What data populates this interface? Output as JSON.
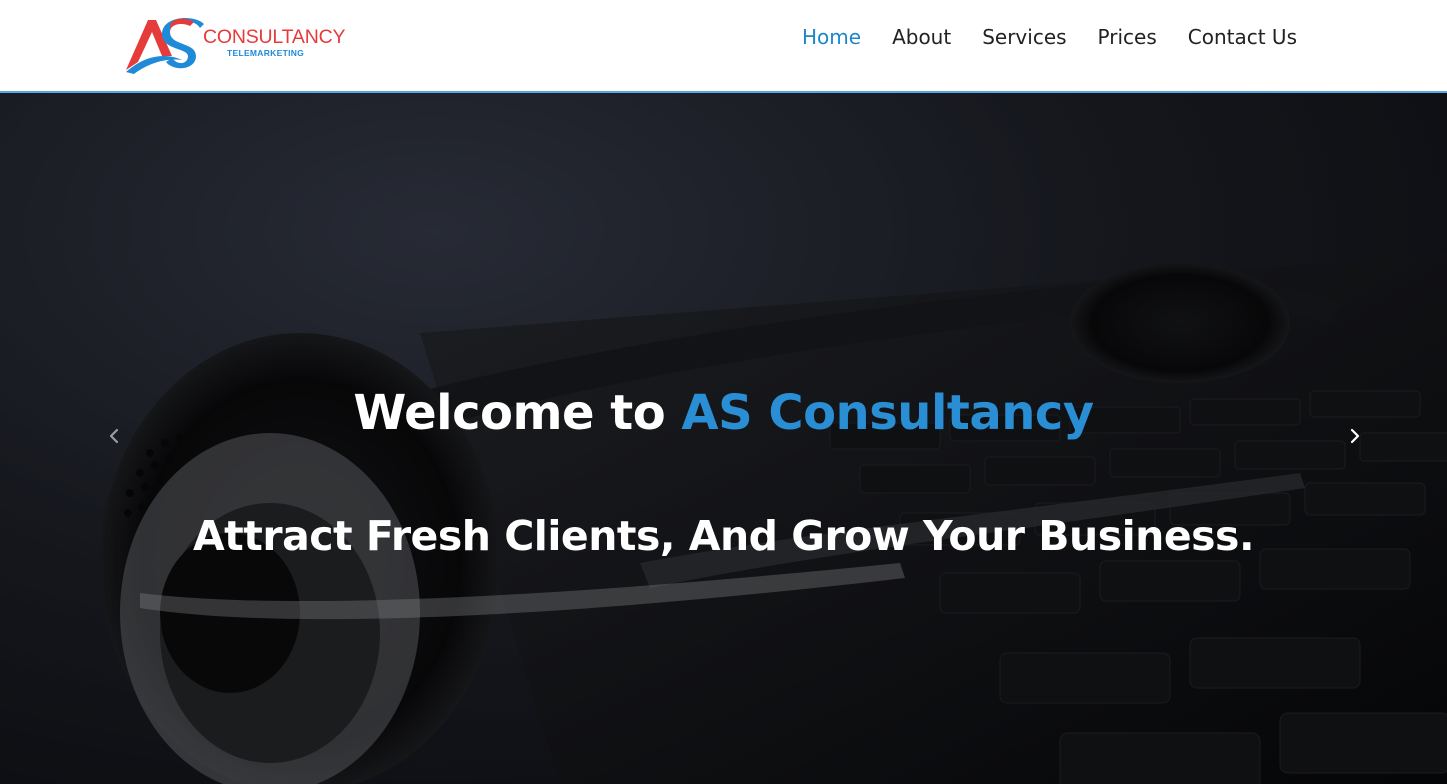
{
  "logo": {
    "initials": "AS",
    "word": "CONSULTANCY",
    "tagline": "TELEMARKETING",
    "colors": {
      "red": "#e63b3b",
      "blue": "#1f8ad8"
    }
  },
  "nav": {
    "items": [
      {
        "label": "Home",
        "active": true
      },
      {
        "label": "About",
        "active": false
      },
      {
        "label": "Services",
        "active": false
      },
      {
        "label": "Prices",
        "active": false
      },
      {
        "label": "Contact Us",
        "active": false
      }
    ],
    "active_color": "#1f86c9"
  },
  "hero": {
    "title_prefix": "Welcome to ",
    "title_accent": "AS Consultancy",
    "subtitle": "Attract Fresh Clients, And Grow Your Business.",
    "accent_color": "#2a8ed4",
    "background_subject": "headset on keyboard (dark overlay)",
    "prev_icon": "chevron-left-icon",
    "next_icon": "chevron-right-icon"
  }
}
